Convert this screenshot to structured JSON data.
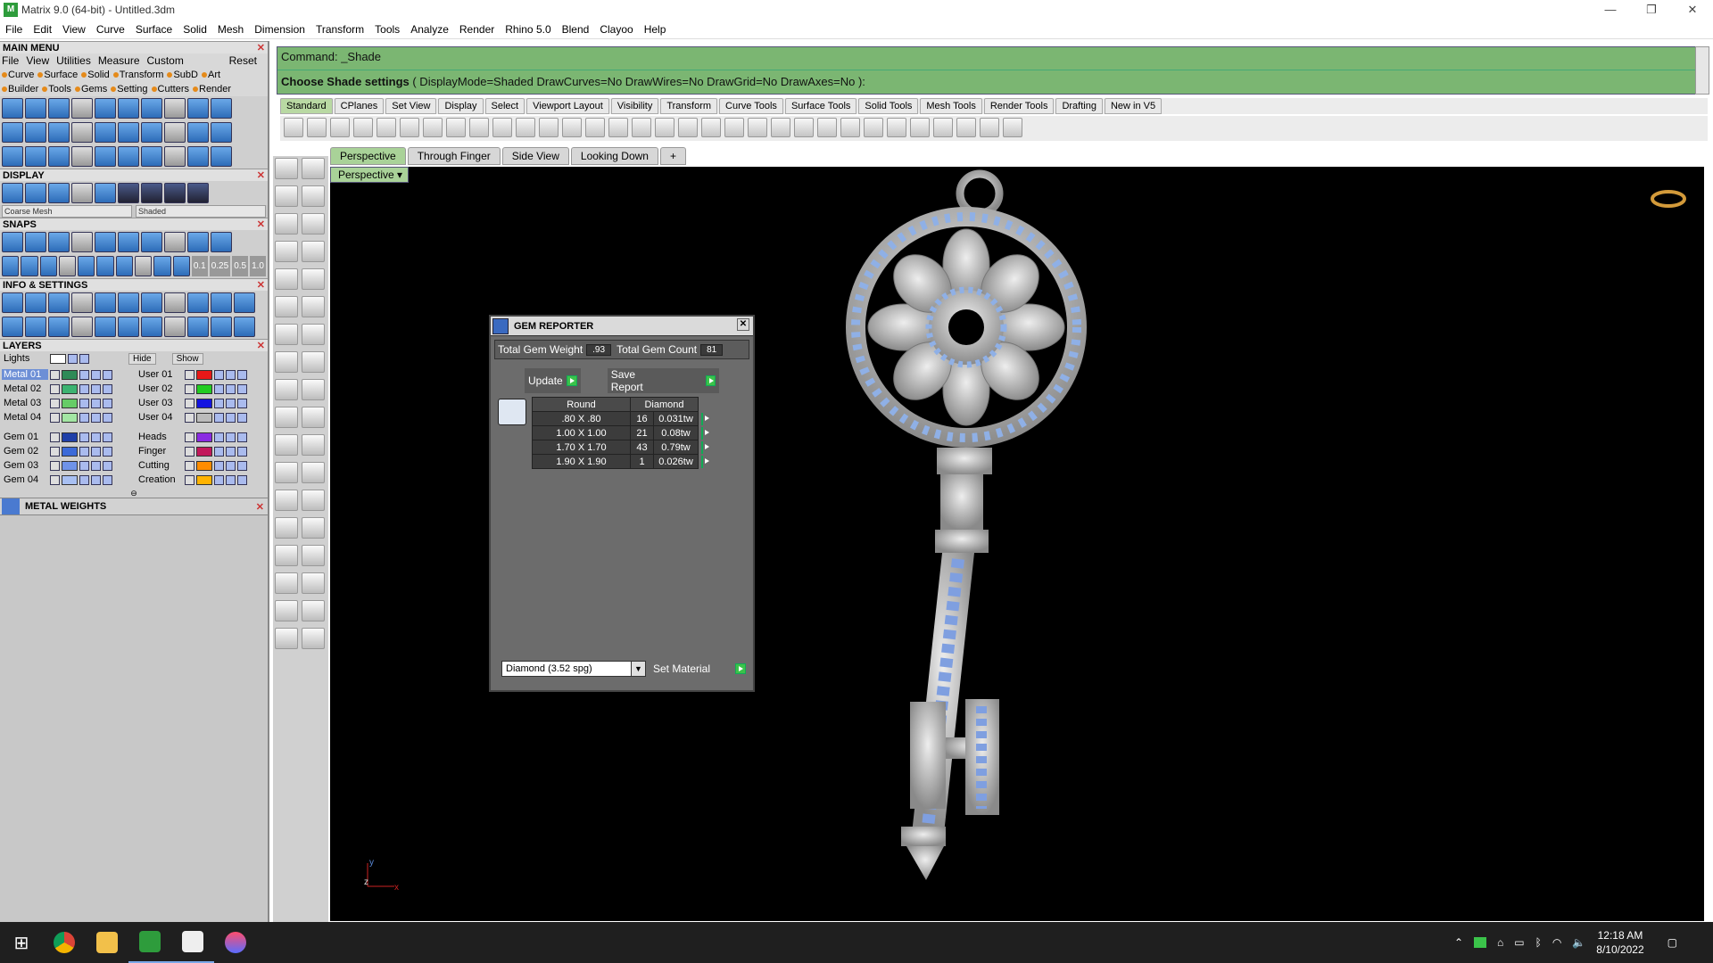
{
  "window": {
    "title": "Matrix 9.0 (64-bit) - Untitled.3dm",
    "controls": [
      "—",
      "❐",
      "✕"
    ]
  },
  "menubar": [
    "File",
    "Edit",
    "View",
    "Curve",
    "Surface",
    "Solid",
    "Mesh",
    "Dimension",
    "Transform",
    "Tools",
    "Analyze",
    "Render",
    "Rhino 5.0",
    "Blend",
    "Clayoo",
    "Help"
  ],
  "mainmenu": {
    "title": "MAIN MENU",
    "row1": [
      "File",
      "View",
      "Utilities",
      "Measure",
      "Custom"
    ],
    "reset": "Reset",
    "row2": [
      "Curve",
      "Surface",
      "Solid",
      "Transform",
      "SubD",
      "Art"
    ],
    "row3": [
      "Builder",
      "Tools",
      "Gems",
      "Setting",
      "Cutters",
      "Render"
    ]
  },
  "display": {
    "title": "DISPLAY",
    "mesh": "Coarse Mesh",
    "mode": "Shaded"
  },
  "snaps": {
    "title": "SNAPS",
    "values": [
      "0.1",
      "0.25",
      "0.5",
      "1.0"
    ]
  },
  "info": {
    "title": "INFO & SETTINGS"
  },
  "layers": {
    "title": "LAYERS",
    "lights": "Lights",
    "hide": "Hide",
    "show": "Show",
    "left": [
      {
        "name": "Metal 01",
        "color": "#2e8b57"
      },
      {
        "name": "Metal 02",
        "color": "#3cb371"
      },
      {
        "name": "Metal 03",
        "color": "#66cc66"
      },
      {
        "name": "Metal 04",
        "color": "#a3e6a3"
      },
      {
        "name": "Gem 01",
        "color": "#1f3fa8"
      },
      {
        "name": "Gem 02",
        "color": "#3c6ad8"
      },
      {
        "name": "Gem 03",
        "color": "#6f93e8"
      },
      {
        "name": "Gem 04",
        "color": "#a8c0f2"
      }
    ],
    "right": [
      {
        "name": "User 01",
        "color": "#e81818"
      },
      {
        "name": "User 02",
        "color": "#22cc22"
      },
      {
        "name": "User 03",
        "color": "#1414e0"
      },
      {
        "name": "User 04",
        "color": "#bbbbbb"
      },
      {
        "name": "Heads",
        "color": "#8a2be2"
      },
      {
        "name": "Finger",
        "color": "#c2185b"
      },
      {
        "name": "Cutting",
        "color": "#ff8c00"
      },
      {
        "name": "Creation",
        "color": "#ffb300"
      }
    ]
  },
  "metalweights": {
    "title": "METAL WEIGHTS"
  },
  "command": {
    "line1": "Command: _Shade",
    "line2_bold": "Choose Shade settings",
    "line2_rest": " ( DisplayMode=Shaded  DrawCurves=No  DrawWires=No  DrawGrid=No  DrawAxes=No ):"
  },
  "toolbar_tabs": [
    "Standard",
    "CPlanes",
    "Set View",
    "Display",
    "Select",
    "Viewport Layout",
    "Visibility",
    "Transform",
    "Curve Tools",
    "Surface Tools",
    "Solid Tools",
    "Mesh Tools",
    "Render Tools",
    "Drafting",
    "New in V5"
  ],
  "viewport_tabs": [
    "Perspective",
    "Through Finger",
    "Side View",
    "Looking Down",
    "+"
  ],
  "viewport_label": "Perspective ▾",
  "gem_reporter": {
    "title": "GEM REPORTER",
    "total_weight_label": "Total Gem Weight",
    "total_weight": ".93",
    "total_count_label": "Total Gem Count",
    "total_count": "81",
    "update": "Update",
    "save_report": "Save Report",
    "headers": [
      "Round",
      "Diamond"
    ],
    "rows": [
      {
        "size": ".80 X .80",
        "count": "16",
        "weight": "0.031tw"
      },
      {
        "size": "1.00 X 1.00",
        "count": "21",
        "weight": "0.08tw"
      },
      {
        "size": "1.70 X 1.70",
        "count": "43",
        "weight": "0.79tw"
      },
      {
        "size": "1.90 X 1.90",
        "count": "1",
        "weight": "0.026tw"
      }
    ],
    "material": "Diamond    (3.52 spg)",
    "set_material": "Set Material"
  },
  "axis": {
    "y": "y",
    "z": "z",
    "x": "x"
  },
  "taskbar": {
    "time": "12:18 AM",
    "date": "8/10/2022"
  },
  "colors": {
    "cmd_bg": "#7bb672",
    "viewport_bg": "#000000",
    "accent": "#a9d298"
  }
}
